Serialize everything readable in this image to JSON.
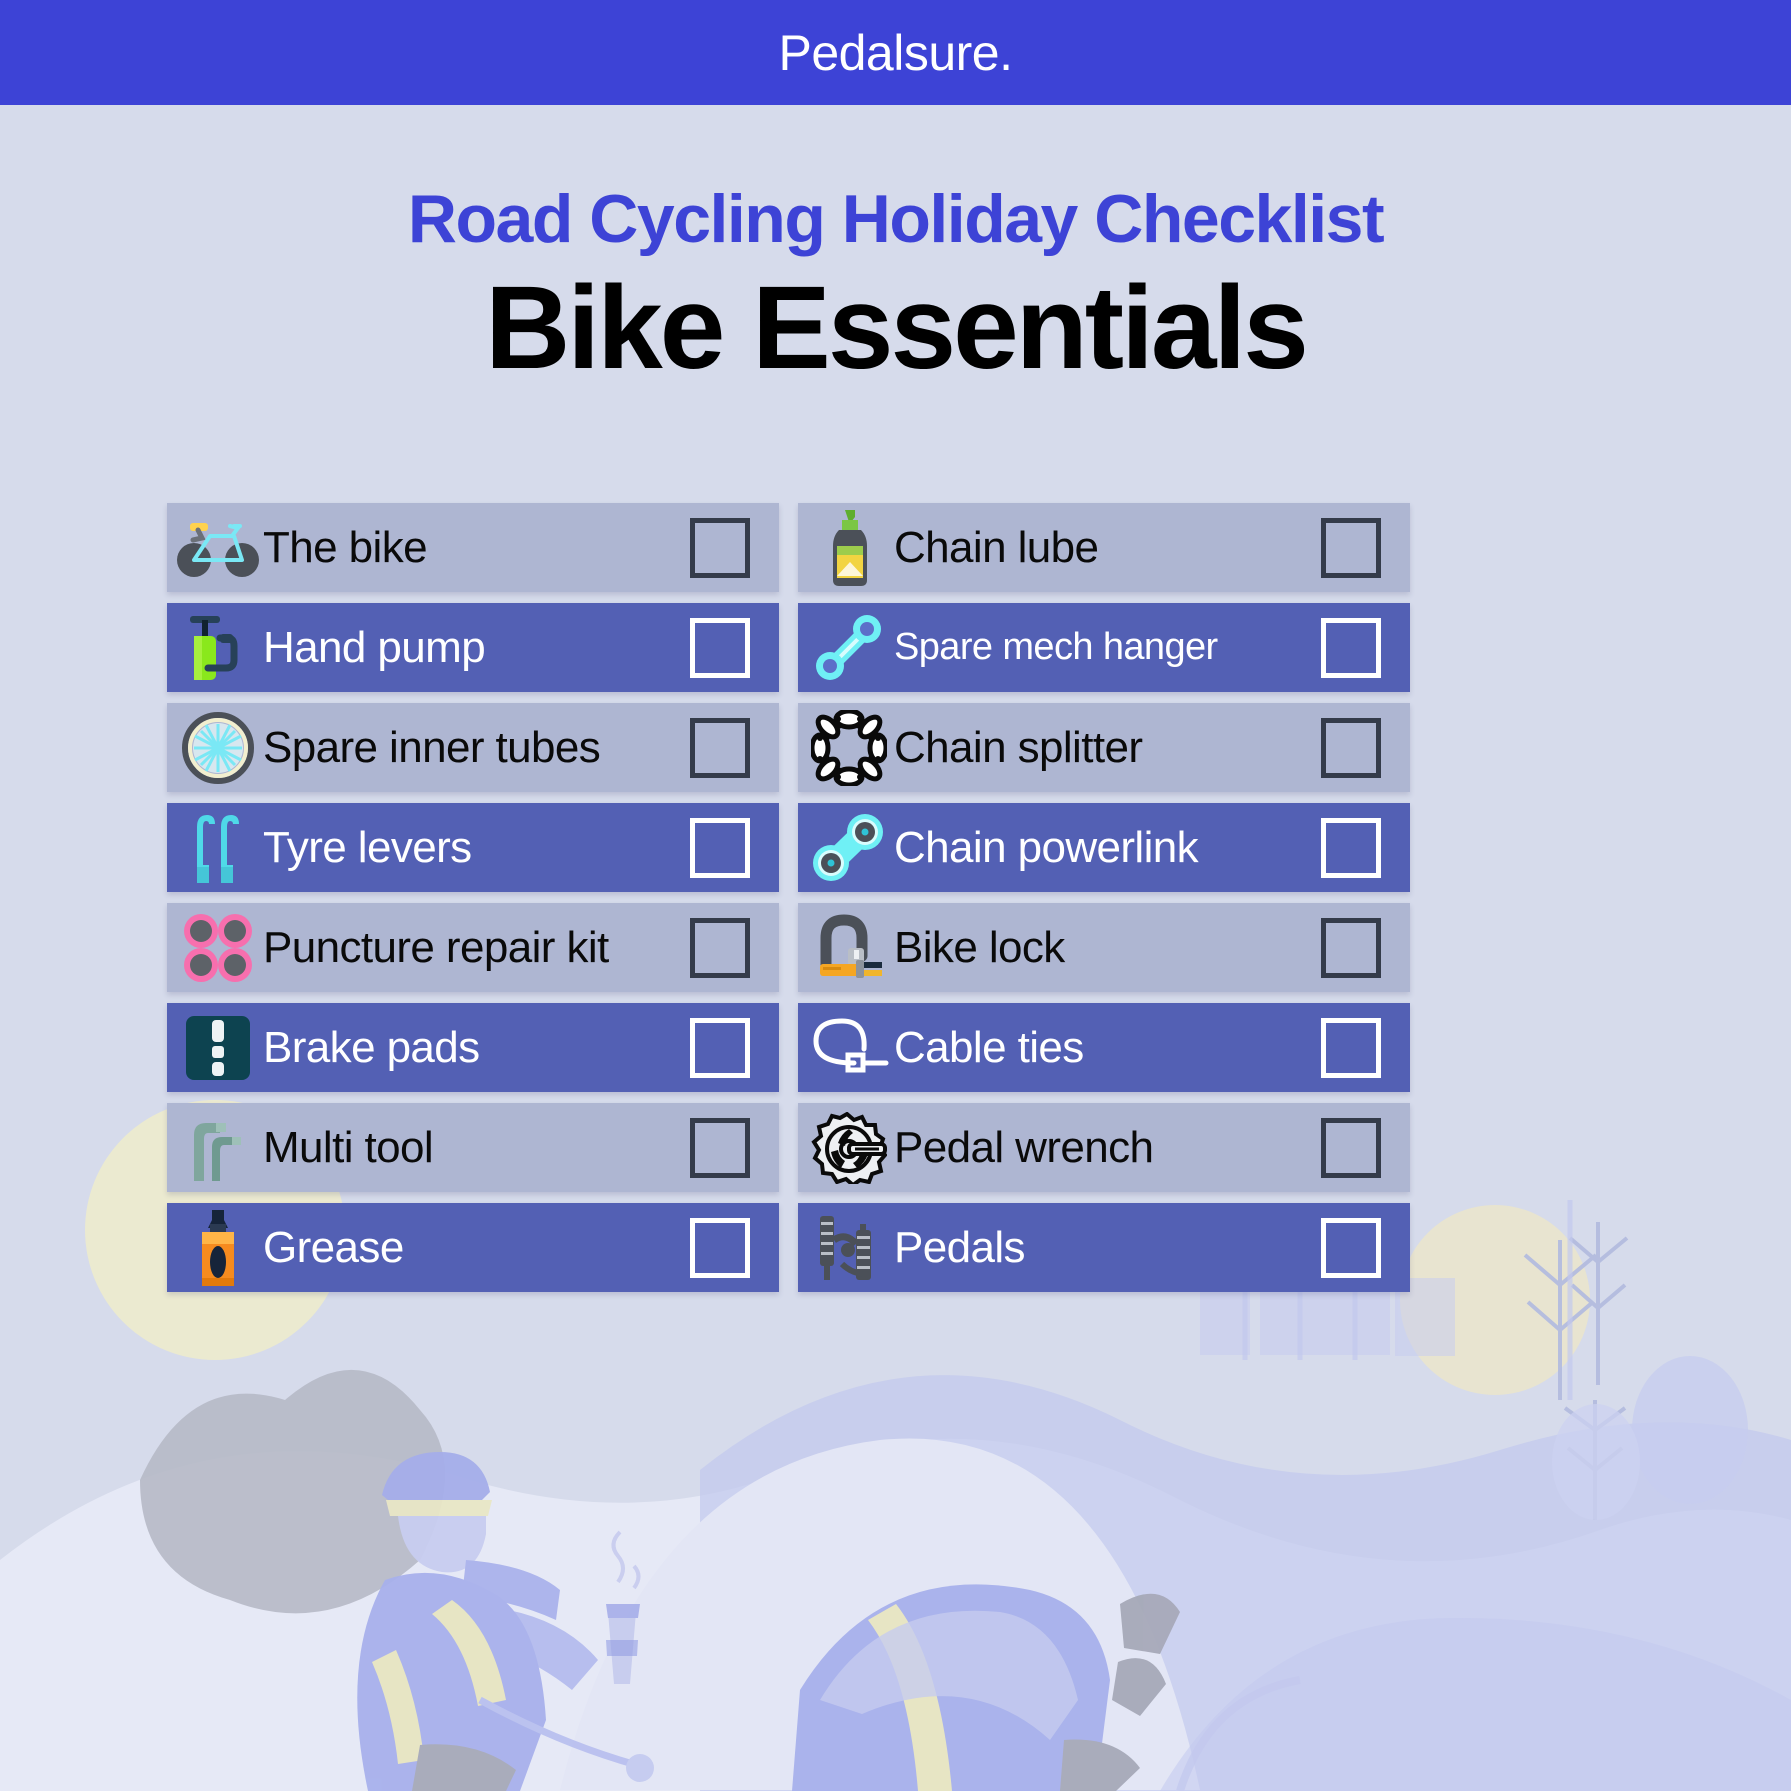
{
  "brand": {
    "name": "Pedalsure."
  },
  "headings": {
    "eyebrow": "Road Cycling Holiday Checklist",
    "title": "Bike Essentials"
  },
  "colors": {
    "brand_blue": "#3d43d6",
    "page_background": "#d6dbeb",
    "row_light": "#aeb6d2",
    "row_dark": "#5360b4",
    "title_black": "#000000",
    "label_light_row": "#0a0a0a",
    "label_dark_row": "#ffffff",
    "checkbox_dark_outline": "#343b4a",
    "checkbox_light_outline": "#ffffff"
  },
  "checklist": {
    "left_column": [
      {
        "label": "The bike",
        "icon": "bicycle-icon",
        "row_style": "light",
        "checked": false
      },
      {
        "label": "Hand pump",
        "icon": "hand-pump-icon",
        "row_style": "dark",
        "checked": false
      },
      {
        "label": "Spare inner tubes",
        "icon": "wheel-icon",
        "row_style": "light",
        "checked": false
      },
      {
        "label": "Tyre levers",
        "icon": "tyre-levers-icon",
        "row_style": "dark",
        "checked": false
      },
      {
        "label": "Puncture repair kit",
        "icon": "puncture-repair-kit-icon",
        "row_style": "light",
        "checked": false
      },
      {
        "label": "Brake pads",
        "icon": "brake-pads-icon",
        "row_style": "dark",
        "checked": false
      },
      {
        "label": "Multi tool",
        "icon": "multi-tool-icon",
        "row_style": "light",
        "checked": false
      },
      {
        "label": "Grease",
        "icon": "grease-icon",
        "row_style": "dark",
        "checked": false
      }
    ],
    "right_column": [
      {
        "label": "Chain lube",
        "icon": "chain-lube-icon",
        "row_style": "light",
        "checked": false
      },
      {
        "label": "Spare mech hanger",
        "icon": "mech-hanger-icon",
        "row_style": "dark",
        "checked": false
      },
      {
        "label": "Chain splitter",
        "icon": "chain-splitter-icon",
        "row_style": "light",
        "checked": false
      },
      {
        "label": "Chain powerlink",
        "icon": "chain-powerlink-icon",
        "row_style": "dark",
        "checked": false
      },
      {
        "label": "Bike lock",
        "icon": "bike-lock-icon",
        "row_style": "light",
        "checked": false
      },
      {
        "label": "Cable ties",
        "icon": "cable-tie-icon",
        "row_style": "dark",
        "checked": false
      },
      {
        "label": "Pedal wrench",
        "icon": "pedal-wrench-icon",
        "row_style": "light",
        "checked": false
      },
      {
        "label": "Pedals",
        "icon": "pedals-icon",
        "row_style": "dark",
        "checked": false
      }
    ]
  }
}
